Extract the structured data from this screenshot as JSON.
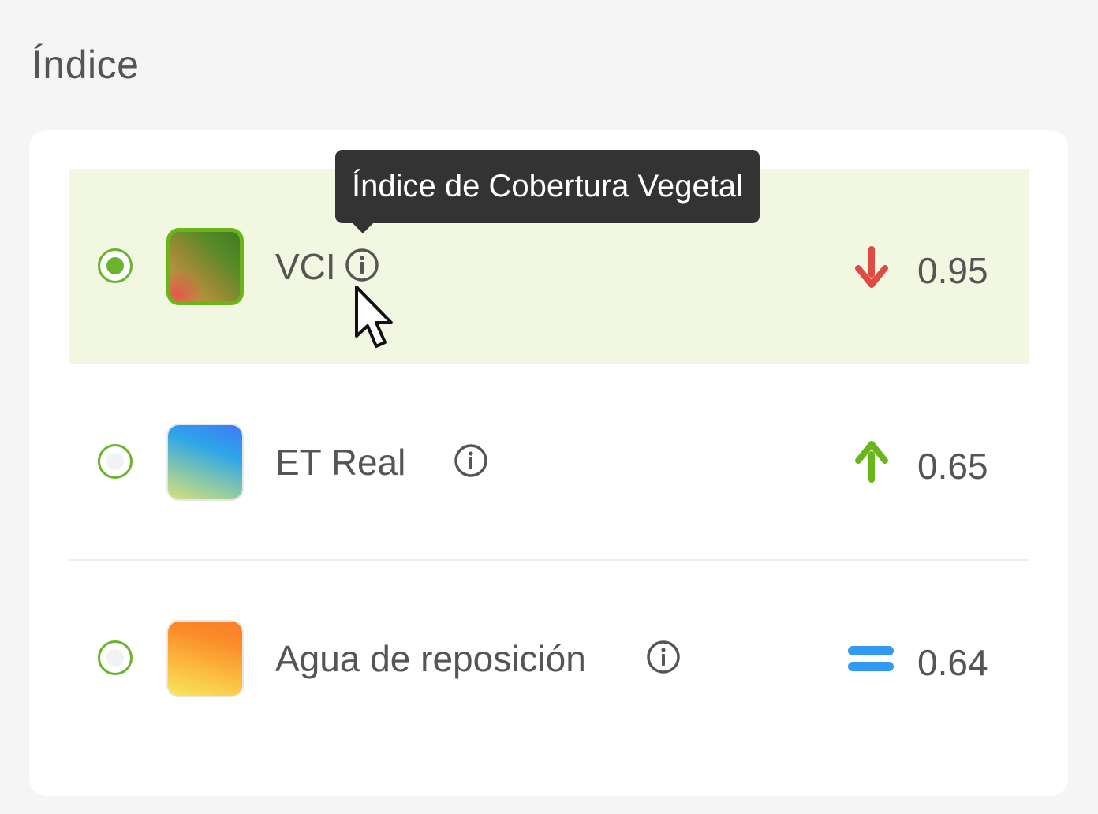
{
  "section": {
    "title": "Índice"
  },
  "tooltip": {
    "text": "Índice de Cobertura Vegetal"
  },
  "colors": {
    "accent": "#6ab42d",
    "selected_row_bg": "#f1f7e1",
    "trend_down": "#e04a44",
    "trend_up": "#6ab61a",
    "trend_equal": "#3399f3"
  },
  "indices": [
    {
      "label": "VCI",
      "value": "0.95",
      "trend": "arrow-down-icon",
      "selected": true
    },
    {
      "label": "ET Real",
      "value": "0.65",
      "trend": "arrow-up-icon",
      "selected": false
    },
    {
      "label": "Agua de reposición",
      "value": "0.64",
      "trend": "equals-icon",
      "selected": false
    }
  ]
}
